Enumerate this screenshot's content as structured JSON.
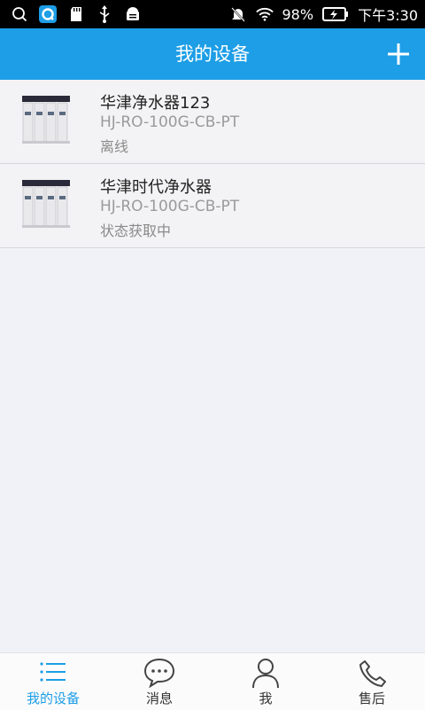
{
  "status_bar": {
    "battery": "98%",
    "time": "下午3:30"
  },
  "header": {
    "title": "我的设备",
    "add_icon": "plus-icon"
  },
  "devices": [
    {
      "name": "华津净水器123",
      "model": "HJ-RO-100G-CB-PT",
      "status": "离线"
    },
    {
      "name": "华津时代净水器",
      "model": "HJ-RO-100G-CB-PT",
      "status": "状态获取中"
    }
  ],
  "tabs": [
    {
      "label": "我的设备",
      "icon": "list-icon",
      "active": true
    },
    {
      "label": "消息",
      "icon": "chat-bubble-icon",
      "active": false
    },
    {
      "label": "我",
      "icon": "person-icon",
      "active": false
    },
    {
      "label": "售后",
      "icon": "phone-icon",
      "active": false
    }
  ],
  "colors": {
    "accent": "#1d9ee6",
    "background": "#f0f2f7"
  }
}
